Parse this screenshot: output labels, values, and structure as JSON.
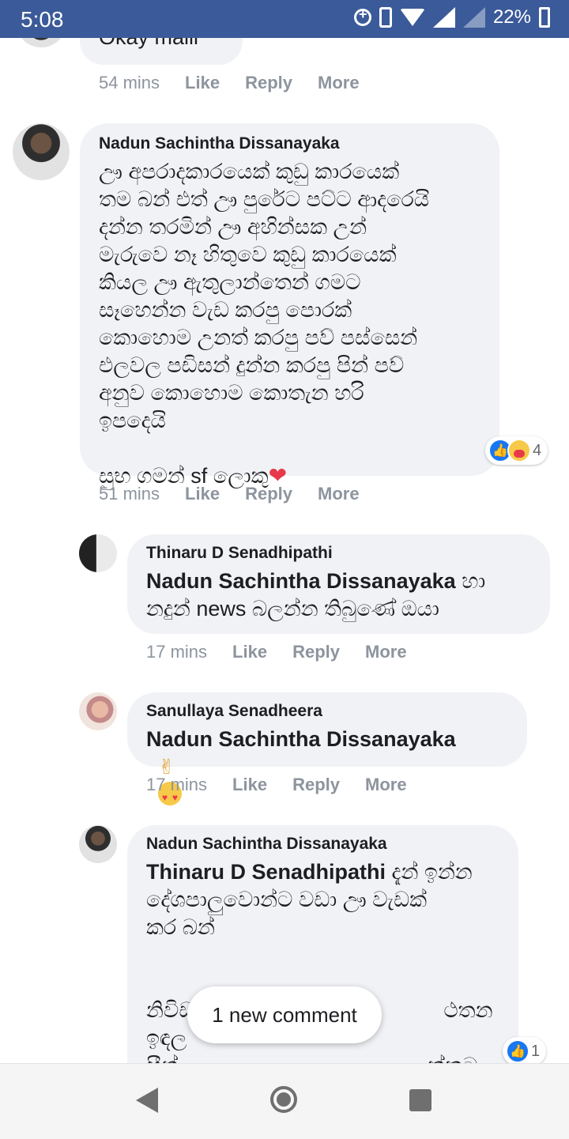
{
  "status_bar": {
    "time": "5:08",
    "battery": "22%",
    "icons": [
      "data-saver-icon",
      "vibrate-icon",
      "wifi-icon",
      "signal-x-icon",
      "signal-x-icon",
      "battery-charging-icon"
    ]
  },
  "comments": [
    {
      "body_partial": "Okay malli",
      "time": "54 mins",
      "actions": {
        "like": "Like",
        "reply": "Reply",
        "more": "More"
      }
    },
    {
      "author": "Nadun Sachintha Dissanayaka",
      "body": "ඌ අපරාදකාරයෙක් කුඩු කාරයෙක්\nතම බන් එත් ඌ පුරේට පට්ට ආදරෙයි\nදන්න තරමින් ඌ අහින්සක උන්\nමැරුවෙ නෑ හිතුවෙ කුඩු කාරයෙක්\nකියල ඌ ඇතුලාන්තෙන් ගමට\nසෑහෙන්න වැඩ කරපු පොරක්\nකොහොම උනත් කරපු පව් පස්සෙන්\nඑලවල පඩිසන් දුන්න කරපු පින් පව්\nඅනුව කොහොම කොතැන හරි\nඉපදෙයි\n\nසුභ ගමන් sf ලොකු",
      "reaction_count": "4",
      "time": "51 mins",
      "actions": {
        "like": "Like",
        "reply": "Reply",
        "more": "More"
      }
    },
    {
      "author": "Thinaru D Senadhipathi",
      "mention": "Nadun Sachintha Dissanayaka",
      "body": " හා\nනදුන් news බලන්න තිබුණේ ඔයා",
      "time": "17 mins",
      "actions": {
        "like": "Like",
        "reply": "Reply",
        "more": "More"
      }
    },
    {
      "author": "Sanullaya Senadheera",
      "mention": "Nadun Sachintha Dissanayaka",
      "emoji": "✌",
      "time": "17 mins",
      "actions": {
        "like": "Like",
        "reply": "Reply",
        "more": "More"
      }
    },
    {
      "author": "Nadun Sachintha Dissanayaka",
      "mention": "Thinaru D Senadhipathi",
      "body": " දැන් ඉන්න\nදේශපාලුවොන්ට වඩා ඌ වැඩක්\nකර බන්\n\n\nනිවිඩ                                          ථතන ඉඳල\nසීන්                                          ක්කට\nකලින්",
      "reaction_count": "1"
    }
  ],
  "toast": "1 new comment",
  "nav": {
    "back": "back-icon",
    "home": "home-icon",
    "recent": "recents-icon"
  },
  "colors": {
    "status_bar": "#3b5a99",
    "bubble": "#f0f2f5",
    "meta": "#8d949e",
    "like_blue": "#1877f2"
  }
}
